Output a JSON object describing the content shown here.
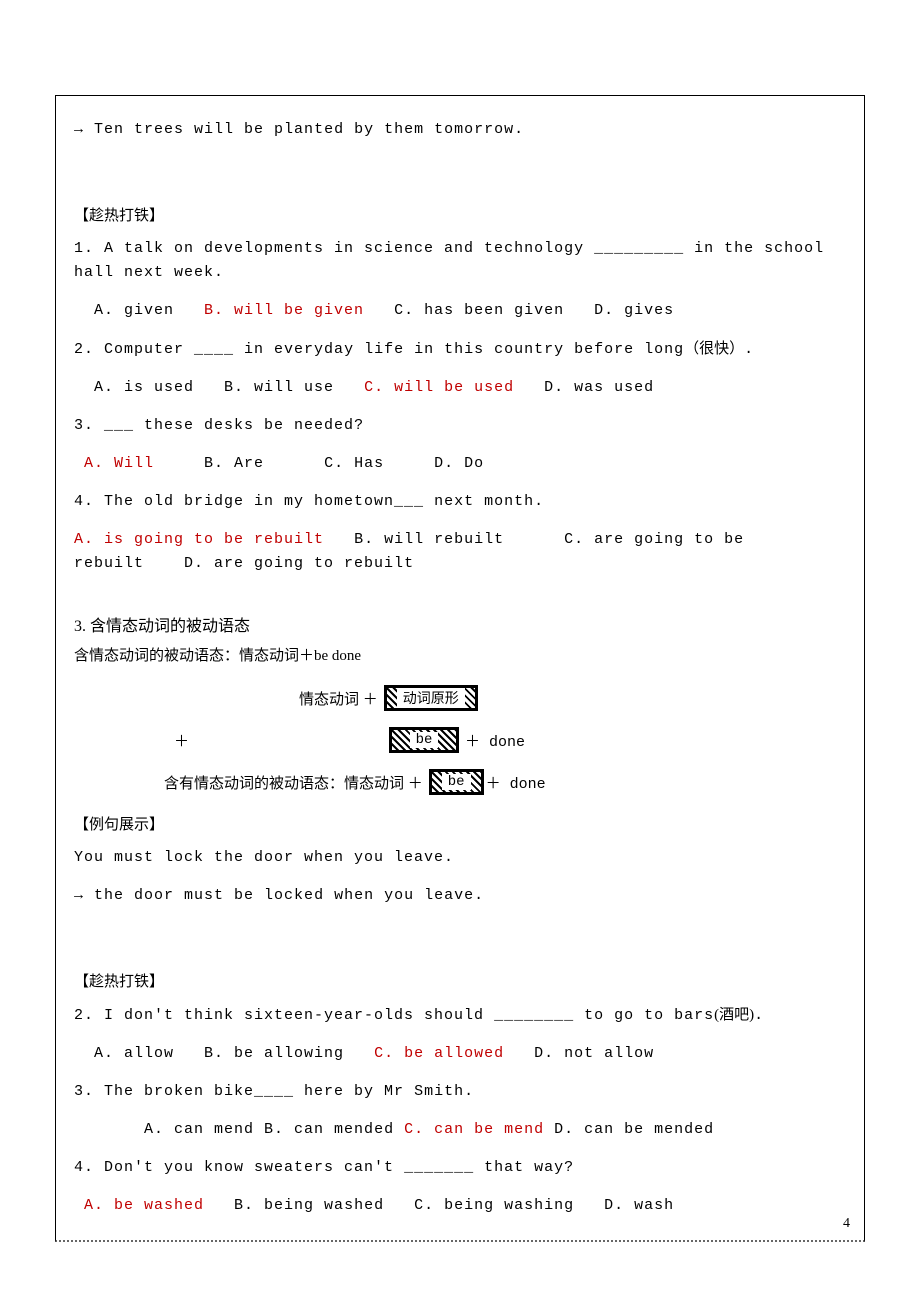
{
  "intro": {
    "arrow": "→",
    "sentence": "Ten trees will be planted by them tomorrow."
  },
  "practice1": {
    "title": "【趁热打铁】",
    "q1": {
      "stem_pre": "1. A talk on developments in science and technology ",
      "blank": "_________",
      "stem_post": " in the school hall next week.",
      "a": "A. given",
      "b": "B. will be given",
      "c": "C. has been given",
      "d": "D. gives"
    },
    "q2": {
      "stem_pre": "2. Computer ",
      "blank": "____",
      "stem_post_a": " in everyday life in this country before long",
      "paren": "（很快）",
      "stem_post_b": ".",
      "a": "A. is used",
      "b": "B. will use",
      "c": "C. will be used",
      "d": "D. was used"
    },
    "q3": {
      "stem_pre": "3. ",
      "blank": "___",
      "stem_post": " these desks be needed?",
      "a": "A. Will",
      "b": "B. Are",
      "c": "C. Has",
      "d": "D. Do"
    },
    "q4": {
      "stem_pre": "4. The old bridge in my hometown",
      "blank": "___",
      "stem_post": " next month.",
      "a": "A. is going to be rebuilt",
      "b": "B. will rebuilt",
      "c": "C. are going to be rebuilt",
      "d": "D. are going to rebuilt"
    }
  },
  "grammar": {
    "heading": "3.   含情态动词的被动语态",
    "subheading": "含情态动词的被动语态：情态动词＋be done",
    "row1_left": "情态动词 ＋",
    "row1_box": "动词原形",
    "row2_plus": "＋",
    "row2_box": "be",
    "row2_right": "＋ done",
    "row3_left": "含有情态动词的被动语态：情态动词 ＋",
    "row3_box": "be",
    "row3_right": "＋ done"
  },
  "example": {
    "title": "【例句展示】",
    "line1": "You must lock the door when you leave.",
    "arrow": "→",
    "line2": "the door must be locked when you leave."
  },
  "practice2": {
    "title": "【趁热打铁】",
    "q2": {
      "stem_pre": "2. I don't think sixteen-year-olds should ",
      "blank": "________",
      "stem_post_a": " to go to bars",
      "paren": "(酒吧)",
      "stem_post_b": ".",
      "a": "A. allow",
      "b": "B. be allowing",
      "c": "C. be allowed",
      "d": "D. not allow"
    },
    "q3": {
      "stem_pre": "3. The broken bike",
      "blank": "____",
      "stem_post": " here by Mr Smith.",
      "a": "A. can mend",
      "b": "B. can mended",
      "c": "C. can be mend",
      "d": "D. can be mended"
    },
    "q4": {
      "stem_pre": "4. Don't you know sweaters can't ",
      "blank": "_______",
      "stem_post": " that way?",
      "a": "A. be washed",
      "b": "B. being washed",
      "c": "C. being washing",
      "d": "D. wash"
    }
  },
  "page_number": "4"
}
